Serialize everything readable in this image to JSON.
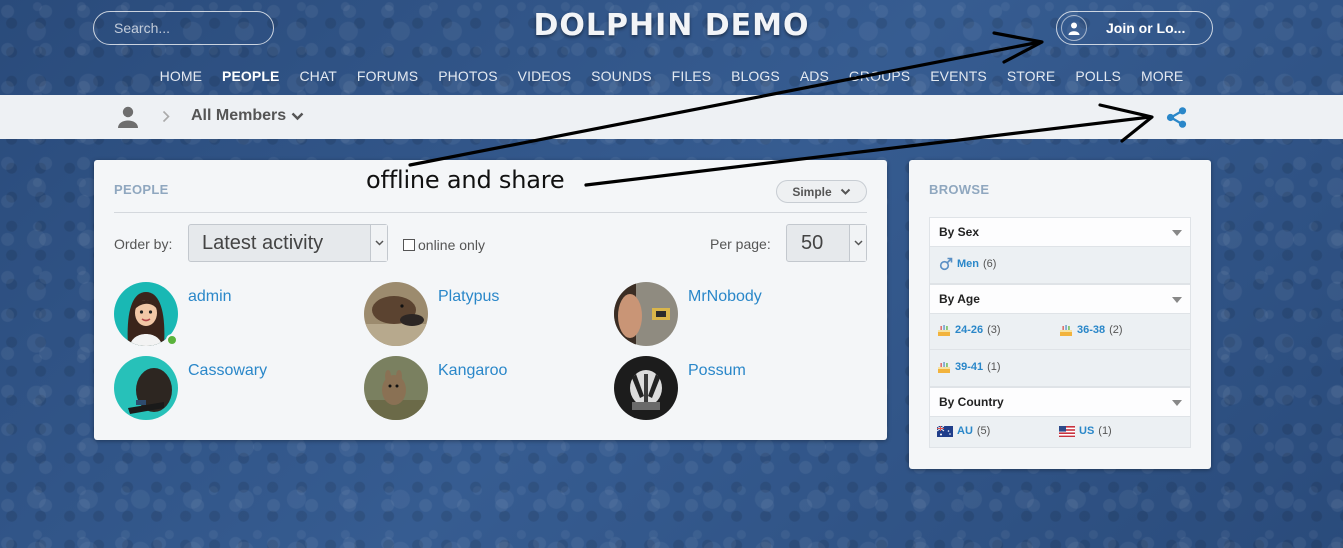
{
  "header": {
    "site_title": "DOLPHIN DEMO",
    "search_placeholder": "Search...",
    "login_label": "Join or Lo..."
  },
  "nav": {
    "items": [
      {
        "label": "HOME",
        "active": false
      },
      {
        "label": "PEOPLE",
        "active": true
      },
      {
        "label": "CHAT",
        "active": false
      },
      {
        "label": "FORUMS",
        "active": false
      },
      {
        "label": "PHOTOS",
        "active": false
      },
      {
        "label": "VIDEOS",
        "active": false
      },
      {
        "label": "SOUNDS",
        "active": false
      },
      {
        "label": "FILES",
        "active": false
      },
      {
        "label": "BLOGS",
        "active": false
      },
      {
        "label": "ADS",
        "active": false
      },
      {
        "label": "GROUPS",
        "active": false
      },
      {
        "label": "EVENTS",
        "active": false
      },
      {
        "label": "STORE",
        "active": false
      },
      {
        "label": "POLLS",
        "active": false
      },
      {
        "label": "MORE",
        "active": false
      }
    ]
  },
  "breadcrumb": {
    "title": "All Members"
  },
  "people": {
    "heading": "PEOPLE",
    "view_mode": "Simple",
    "order_label": "Order by:",
    "order_value": "Latest activity",
    "online_only_label": "online only",
    "online_only_checked": false,
    "per_page_label": "Per page:",
    "per_page_value": "50",
    "members": [
      {
        "name": "admin",
        "online": true,
        "icon": "cartoon-woman-avatar"
      },
      {
        "name": "Platypus",
        "online": false,
        "icon": "platypus-photo"
      },
      {
        "name": "MrNobody",
        "online": false,
        "icon": "person-photo"
      },
      {
        "name": "Cassowary",
        "online": false,
        "icon": "cassowary-photo"
      },
      {
        "name": "Kangaroo",
        "online": false,
        "icon": "kangaroo-photo"
      },
      {
        "name": "Possum",
        "online": false,
        "icon": "possum-photo"
      }
    ]
  },
  "browse": {
    "heading": "BROWSE",
    "by_sex": {
      "title": "By Sex",
      "items": [
        {
          "label": "Men",
          "count": "(6)",
          "icon": "male-symbol-icon"
        }
      ]
    },
    "by_age": {
      "title": "By Age",
      "items": [
        {
          "label": "24-26",
          "count": "(3)",
          "icon": "birthday-cake-icon"
        },
        {
          "label": "36-38",
          "count": "(2)",
          "icon": "birthday-cake-icon"
        },
        {
          "label": "39-41",
          "count": "(1)",
          "icon": "birthday-cake-icon"
        }
      ]
    },
    "by_country": {
      "title": "By Country",
      "items": [
        {
          "label": "AU",
          "count": "(5)",
          "icon": "australia-flag-icon"
        },
        {
          "label": "US",
          "count": "(1)",
          "icon": "us-flag-icon"
        }
      ]
    }
  },
  "annotation": {
    "text": "offline and share",
    "color": "#000000"
  },
  "colors": {
    "link": "#2a87c9",
    "heading_muted": "#8fa7bf",
    "online": "#5ab33c",
    "page_background": "#2d4f80"
  }
}
